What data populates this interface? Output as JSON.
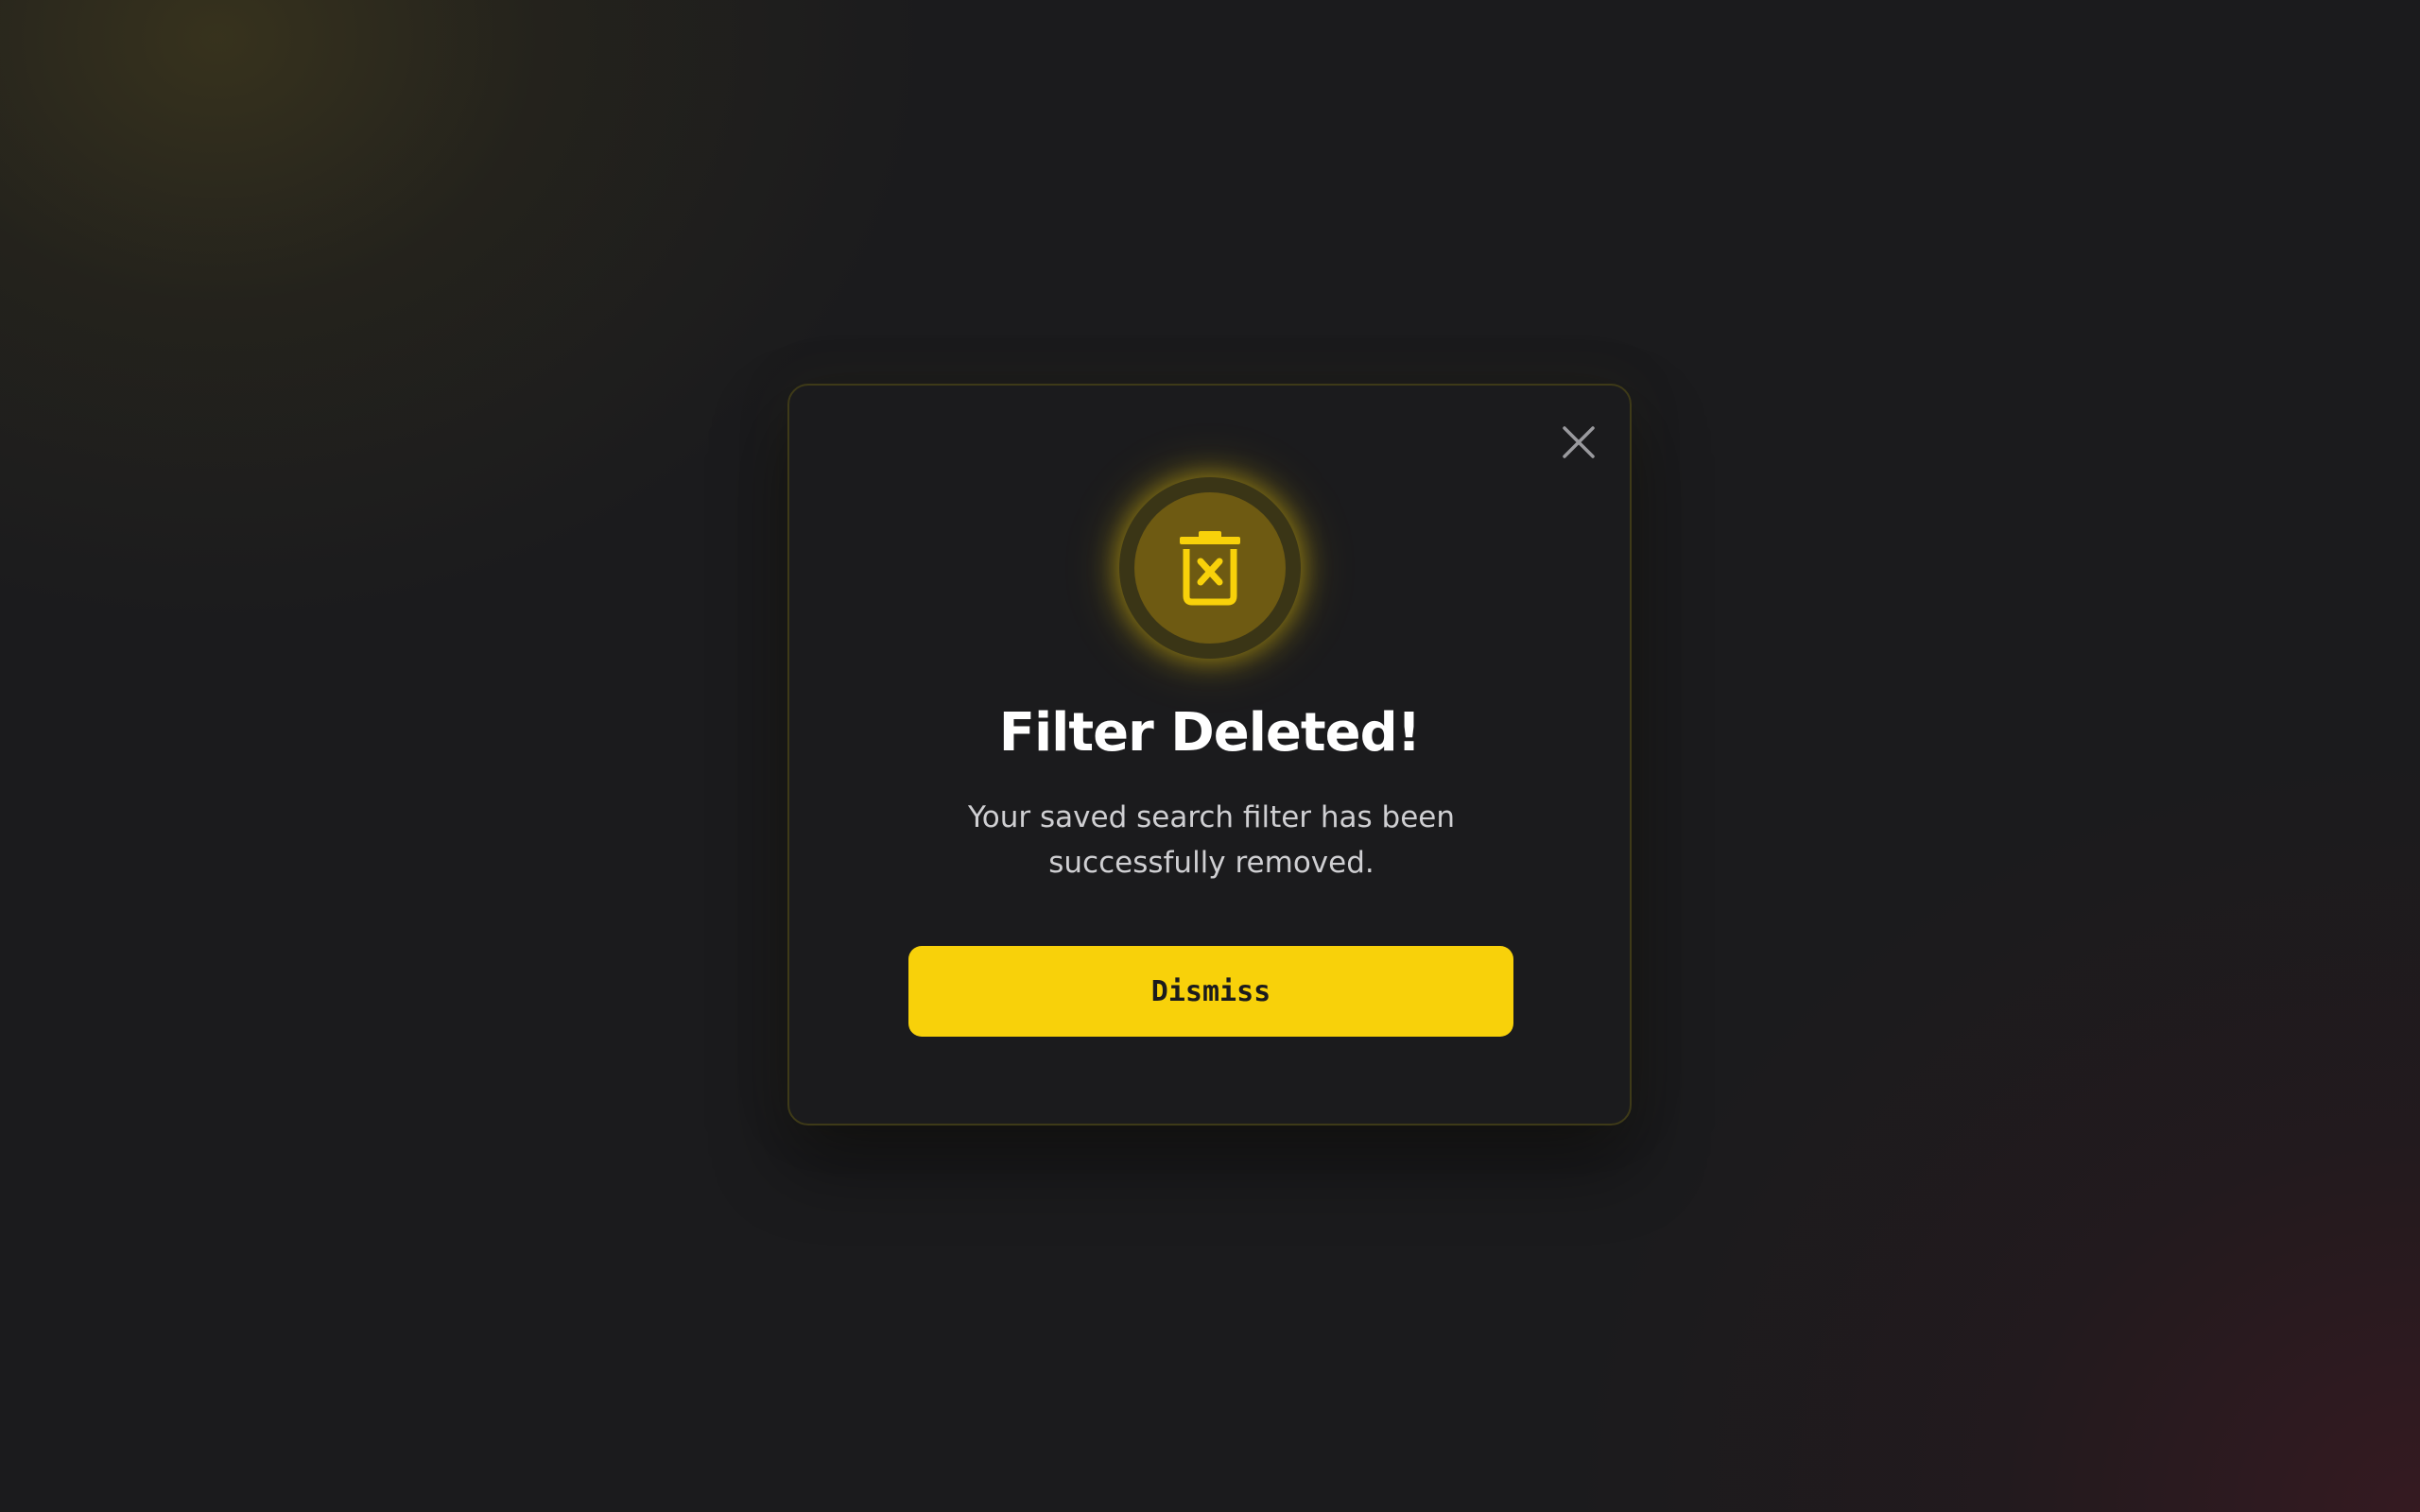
{
  "dialog": {
    "title": "Filter Deleted!",
    "message": "Your saved search filter has been successfully removed.",
    "dismiss_label": "Dismiss",
    "close_icon": "close-icon",
    "status_icon": "trash-x-icon"
  },
  "colors": {
    "background": "#1b1b1d",
    "accent": "#f8d10a",
    "icon_circle": "#6e5a12",
    "title": "#ffffff",
    "message": "#cfcfd2"
  }
}
